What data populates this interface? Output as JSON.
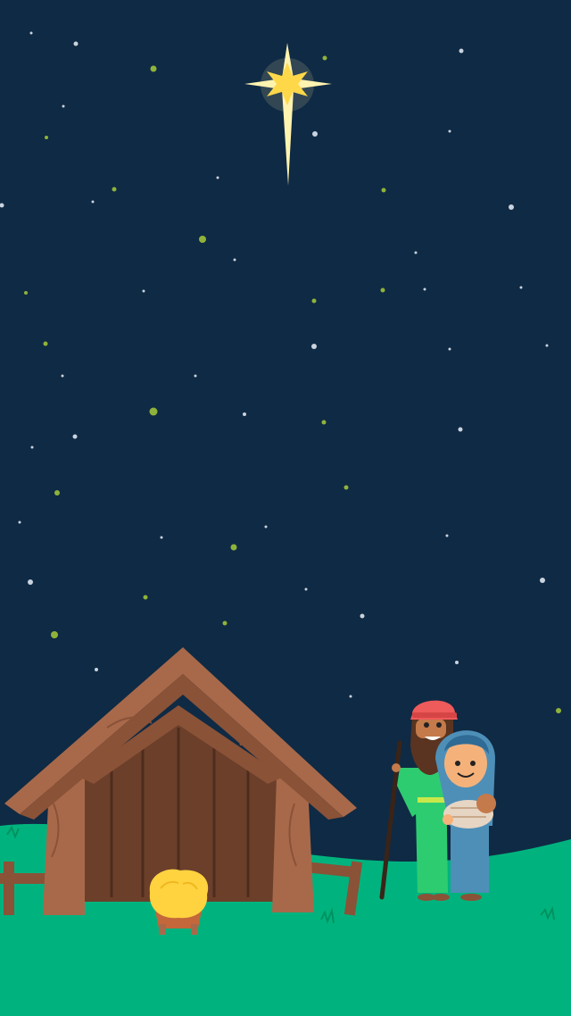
{
  "scene": {
    "colors": {
      "sky": "#0f2a44",
      "grass": "#00b37e",
      "grass_dark": "#00a06f",
      "star_glow": "#fff3b0",
      "star_core": "#ffd84a",
      "dot_white": "#c9d3df",
      "dot_green": "#8fb33a",
      "wood_dark": "#6b3f2a",
      "wood_mid": "#8a5237",
      "wood_light": "#a8694a",
      "straw": "#ffd23f",
      "joseph_robe": "#2ecc71",
      "joseph_hat": "#ef5a5a",
      "mary_robe": "#4e8fb8",
      "skin": "#f4b27a"
    },
    "figures": [
      "north-star",
      "stable",
      "manger",
      "joseph",
      "mary",
      "baby-jesus"
    ]
  }
}
